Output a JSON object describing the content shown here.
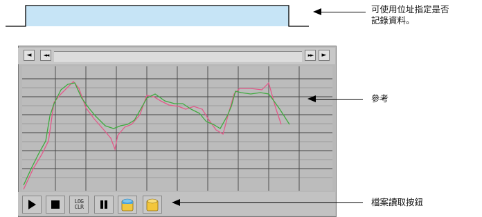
{
  "annotations": {
    "address_range": "可使用位址指定是否\n記錄資料。",
    "reference": "參考",
    "file_read_buttons": "檔案讀取按鈕"
  },
  "scope": {
    "scroll_buttons": {
      "left": "◄",
      "rewind": "◄◄",
      "fast_forward": "►►",
      "right": "►"
    },
    "toolbar": {
      "play": "play-icon",
      "stop": "stop-icon",
      "log_clear": "LOG\nCLR",
      "pause": "pause-icon",
      "open_file_1": "file-open-icon",
      "open_file_2": "file-open-icon"
    },
    "colors": {
      "range_fill": "#c6e4f6",
      "trace_green": "#3faa3f",
      "trace_pink": "#e35a8a",
      "plot_bg": "#bcbcbc"
    }
  }
}
